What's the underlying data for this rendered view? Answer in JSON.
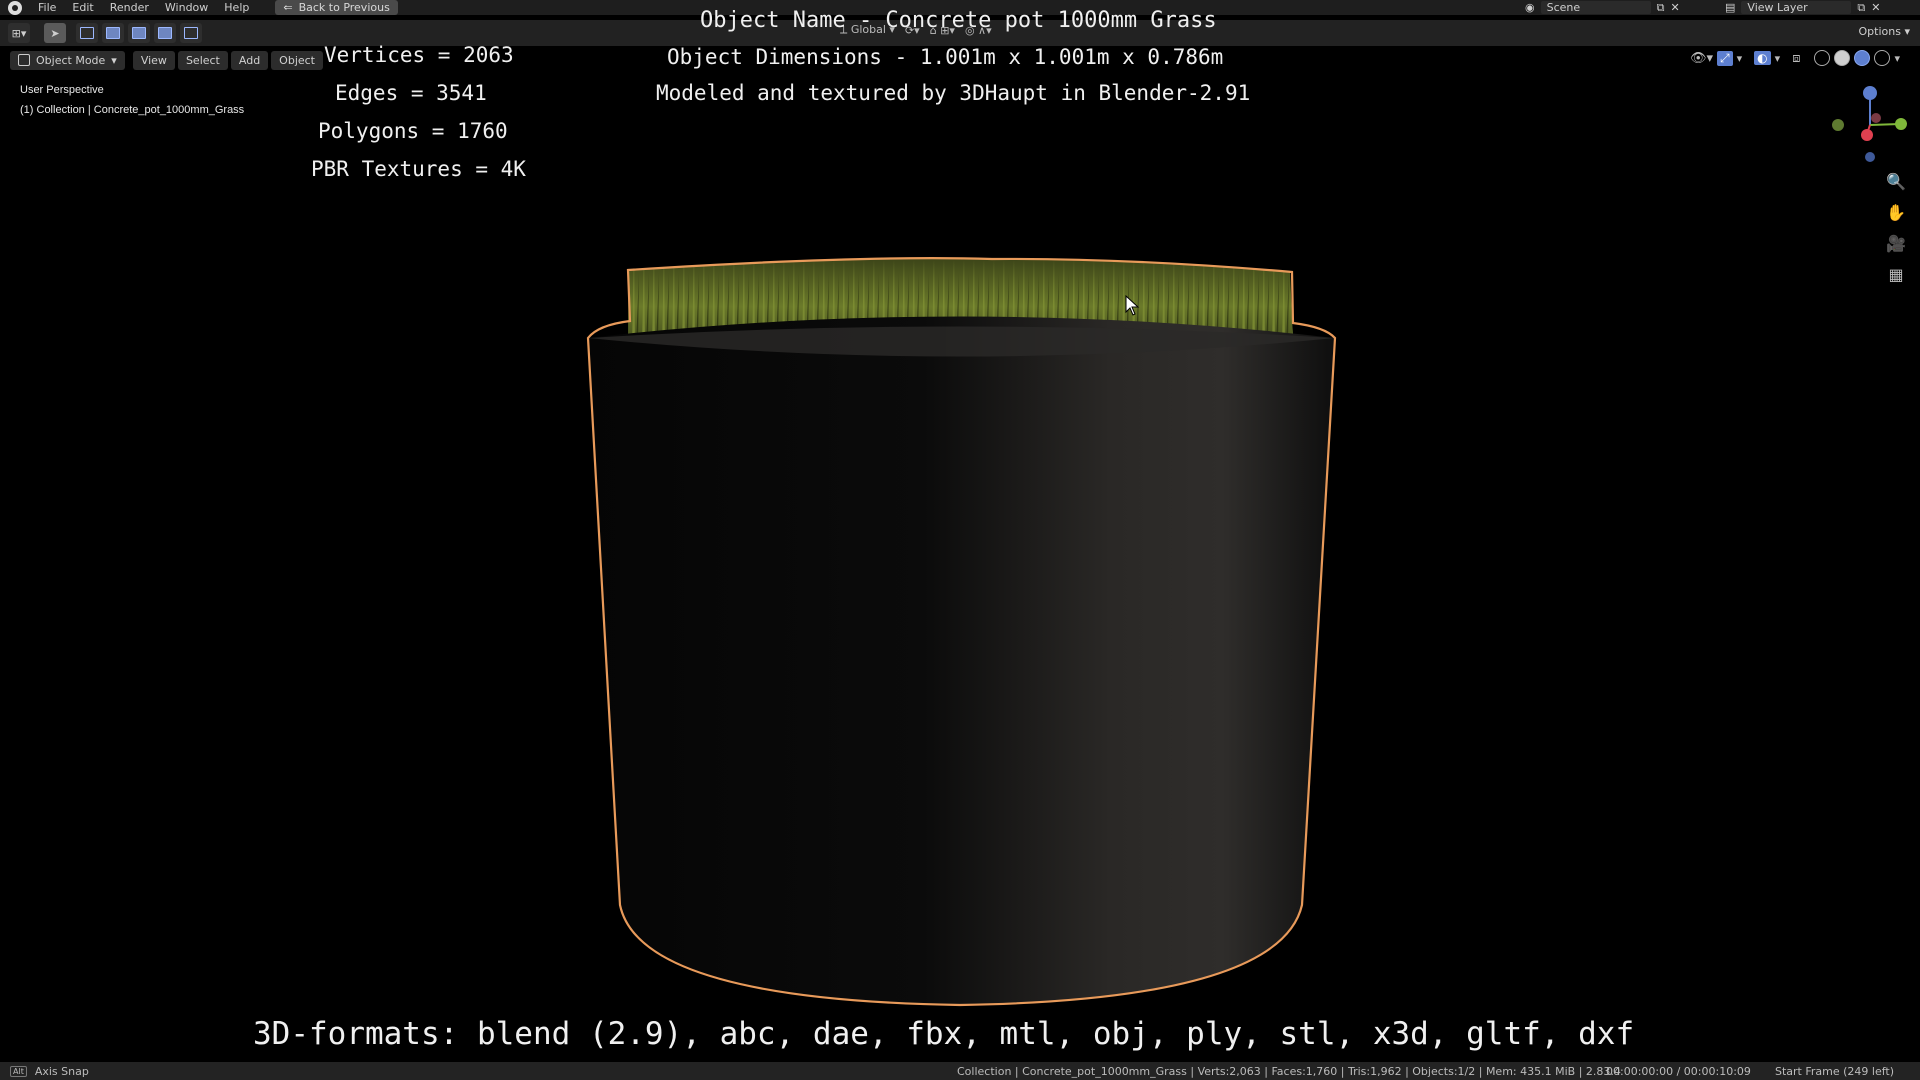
{
  "menu": {
    "items": [
      "File",
      "Edit",
      "Render",
      "Window",
      "Help"
    ],
    "back_button": "Back to Previous"
  },
  "topright": {
    "scene": "Scene",
    "view_layer": "View Layer"
  },
  "toolrow": {
    "orientation": "Global",
    "options": "Options"
  },
  "viewport_header": {
    "mode": "Object Mode",
    "view": "View",
    "select": "Select",
    "add": "Add",
    "object": "Object"
  },
  "viewport_info": {
    "perspective": "User Perspective",
    "collection": "(1) Collection | Concrete_pot_1000mm_Grass"
  },
  "overlay": {
    "object_name": "Object Name - Concrete pot 1000mm Grass",
    "dimensions": "Object Dimensions -  1.001m x 1.001m x 0.786m",
    "credit": "Modeled and textured by 3DHaupt in Blender-2.91",
    "vertices": "Vertices = 2063",
    "edges": "Edges = 3541",
    "polygons": "Polygons = 1760",
    "textures": "PBR Textures = 4K",
    "formats": "3D-formats: blend (2.9), abc, dae, fbx, mtl, obj, ply, stl, x3d, gltf, dxf"
  },
  "statusbar": {
    "left": "Axis Snap",
    "stats": "Collection | Concrete_pot_1000mm_Grass | Verts:2,063 | Faces:1,760 | Tris:1,962 | Objects:1/2 | Mem: 435.1 MiB | 2.83.4",
    "time": "00:00:00:00 / 00:00:10:09",
    "frame": "Start Frame (249 left)"
  },
  "colors": {
    "outline": "#e89a5a",
    "grass": "#6b7a2a",
    "accent": "#5d7fd0"
  }
}
